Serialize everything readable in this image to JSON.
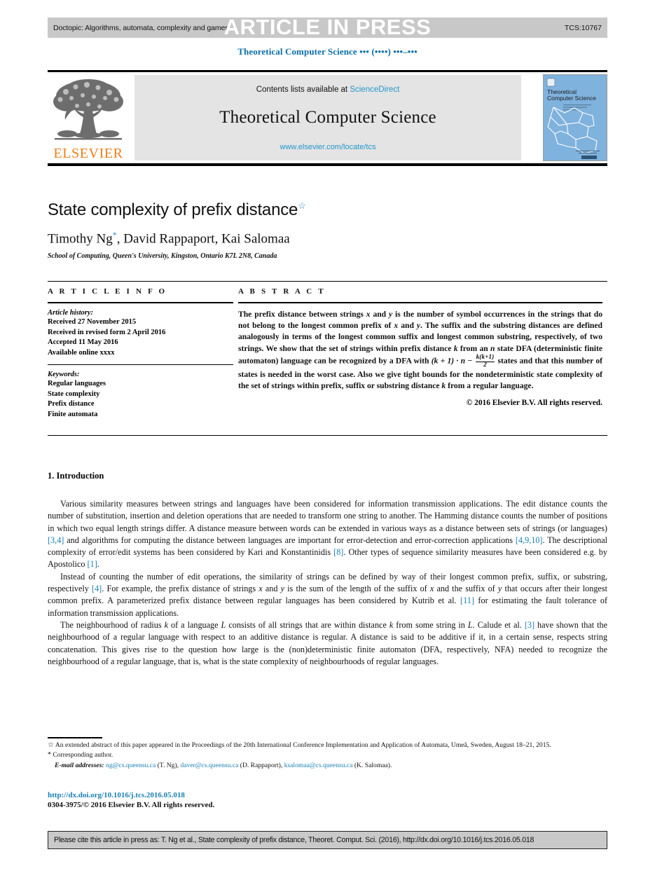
{
  "header": {
    "doctopic": "Doctopic: Algorithms, automata, complexity and games",
    "article_in_press": "ARTICLE IN PRESS",
    "tcs_code": "TCS:10767",
    "running_head": "Theoretical Computer Science ••• (••••) •••–•••"
  },
  "masthead": {
    "contents_prefix": "Contents lists available at ",
    "contents_link": "ScienceDirect",
    "journal_name": "Theoretical Computer Science",
    "journal_url": "www.elsevier.com/locate/tcs",
    "publisher": "ELSEVIER",
    "cover_title_line1": "Theoretical",
    "cover_title_line2": "Computer Science"
  },
  "article": {
    "title": "State complexity of prefix distance",
    "title_marker": "☆",
    "authors": "Timothy Ng*, David Rappaport, Kai Salomaa",
    "author_names": "Timothy Ng",
    "author_marker": "*",
    "authors_rest": ", David Rappaport, Kai Salomaa",
    "affiliation": "School of Computing, Queen's University, Kingston, Ontario K7L 2N8, Canada"
  },
  "info": {
    "heading": "A R T I C L E    I N F O",
    "history_label": "Article history:",
    "history": [
      "Received 27 November 2015",
      "Received in revised form 2 April 2016",
      "Accepted 11 May 2016",
      "Available online xxxx"
    ],
    "keywords_label": "Keywords:",
    "keywords": [
      "Regular languages",
      "State complexity",
      "Prefix distance",
      "Finite automata"
    ]
  },
  "abstract": {
    "heading": "A B S T R A C T",
    "part1": "The prefix distance between strings ",
    "var_x": "x",
    "and1": " and ",
    "var_y": "y",
    "part2": " is the number of symbol occurrences in the strings that do not belong to the longest common prefix of ",
    "part3": ". The suffix and the substring distances are defined analogously in terms of the longest common suffix and longest common substring, respectively, of two strings. We show that the set of strings within prefix distance ",
    "var_k": "k",
    "part4": " from an ",
    "var_n": "n",
    "part5": " state DFA (deterministic finite automaton) language can be recognized by a DFA with ",
    "formula_main": "(k + 1) · n − ",
    "formula_num": "k(k+1)",
    "formula_den": "2",
    "part6": " states and that this number of states is needed in the worst case. Also we give tight bounds for the nondeterministic state complexity of the set of strings within prefix, suffix or substring distance ",
    "part7": " from a regular language.",
    "copyright": "© 2016 Elsevier B.V. All rights reserved."
  },
  "body": {
    "section_number_title": "1. Introduction",
    "paragraphs": [
      {
        "segments": [
          {
            "t": "Various similarity measures between strings and languages have been considered for information transmission applications. The edit distance counts the number of substitution, insertion and deletion operations that are needed to transform one string to another. The Hamming distance counts the number of positions in which two equal length strings differ. A distance measure between words can be extended in various ways as a distance between sets of strings (or languages) "
          },
          {
            "t": "[3,4]",
            "k": "ref"
          },
          {
            "t": " and algorithms for computing the distance between languages are important for error-detection and error-correction applications "
          },
          {
            "t": "[4,9,10]",
            "k": "ref"
          },
          {
            "t": ". The descriptional complexity of error/edit systems has been considered by Kari and Konstantinidis "
          },
          {
            "t": "[8]",
            "k": "ref"
          },
          {
            "t": ". Other types of sequence similarity measures have been considered e.g. by Apostolico "
          },
          {
            "t": "[1]",
            "k": "ref"
          },
          {
            "t": "."
          }
        ]
      },
      {
        "segments": [
          {
            "t": "Instead of counting the number of edit operations, the similarity of strings can be defined by way of their longest common prefix, suffix, or substring, respectively "
          },
          {
            "t": "[4]",
            "k": "ref"
          },
          {
            "t": ". For example, the prefix distance of strings "
          },
          {
            "t": "x",
            "k": "i"
          },
          {
            "t": " and "
          },
          {
            "t": "y",
            "k": "i"
          },
          {
            "t": " is the sum of the length of the suffix of "
          },
          {
            "t": "x",
            "k": "i"
          },
          {
            "t": " and the suffix of "
          },
          {
            "t": "y",
            "k": "i"
          },
          {
            "t": " that occurs after their longest common prefix. A parameterized prefix distance between regular languages has been considered by Kutrib et al. "
          },
          {
            "t": "[11]",
            "k": "ref"
          },
          {
            "t": " for estimating the fault tolerance of information transmission applications."
          }
        ]
      },
      {
        "segments": [
          {
            "t": "The neighbourhood of radius "
          },
          {
            "t": "k",
            "k": "i"
          },
          {
            "t": " of a language "
          },
          {
            "t": "L",
            "k": "i"
          },
          {
            "t": " consists of all strings that are within distance "
          },
          {
            "t": "k",
            "k": "i"
          },
          {
            "t": " from some string in "
          },
          {
            "t": "L",
            "k": "i"
          },
          {
            "t": ". Calude et al. "
          },
          {
            "t": "[3]",
            "k": "ref"
          },
          {
            "t": " have shown that the neighbourhood of a regular language with respect to an additive distance is regular. A distance is said to be additive if it, in a certain sense, respects string concatenation. This gives rise to the question how large is the (non)deterministic finite automaton (DFA, respectively, NFA) needed to recognize the neighbourhood of a regular language, that is, what is the state complexity of neighbourhoods of regular languages."
          }
        ]
      }
    ]
  },
  "footnotes": {
    "star_marker": "☆",
    "star_text": "An extended abstract of this paper appeared in the Proceedings of the 20th International Conference Implementation and Application of Automata, Umeå, Sweden, August 18–21, 2015.",
    "corr_marker": "*",
    "corr_text": "Corresponding author.",
    "email_label": "E-mail addresses:",
    "emails": [
      {
        "address": "ng@cs.queensu.ca",
        "person": " (T. Ng), "
      },
      {
        "address": "daver@cs.queensu.ca",
        "person": " (D. Rappaport), "
      },
      {
        "address": "ksalomaa@cs.queensu.ca",
        "person": " (K. Salomaa)."
      }
    ],
    "doi": "http://dx.doi.org/10.1016/j.tcs.2016.05.018",
    "issn": "0304-3975/© 2016 Elsevier B.V. All rights reserved."
  },
  "cite_bar": {
    "text": "Please cite this article in press as: T. Ng et al., State complexity of prefix distance, Theoret. Comput. Sci. (2016), http://dx.doi.org/10.1016/j.tcs.2016.05.018"
  },
  "colors": {
    "link_blue": "#2196c9",
    "ref_blue": "#1a7fb5",
    "elsevier_orange": "#ef7d1a",
    "bar_grey": "#c8c8c8",
    "contents_grey": "#e4e4e4",
    "cover_blue": "#7fb2dd"
  }
}
